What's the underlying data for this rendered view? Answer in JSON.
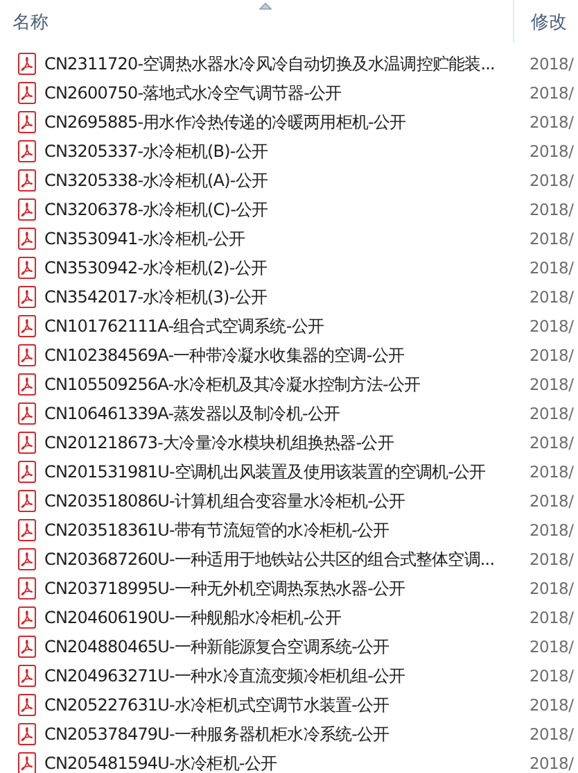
{
  "columns": [
    {
      "label": "名称",
      "sorted": true
    },
    {
      "label": "修改"
    }
  ],
  "rows": [
    {
      "name": "CN2311720-空调热水器水冷风冷自动切换及水温调控贮能装...",
      "modified": "2018/"
    },
    {
      "name": "CN2600750-落地式水冷空气调节器-公开",
      "modified": "2018/"
    },
    {
      "name": "CN2695885-用水作冷热传递的冷暖两用柜机-公开",
      "modified": "2018/"
    },
    {
      "name": "CN3205337-水冷柜机(B)-公开",
      "modified": "2018/"
    },
    {
      "name": "CN3205338-水冷柜机(A)-公开",
      "modified": "2018/"
    },
    {
      "name": "CN3206378-水冷柜机(C)-公开",
      "modified": "2018/"
    },
    {
      "name": "CN3530941-水冷柜机-公开",
      "modified": "2018/"
    },
    {
      "name": "CN3530942-水冷柜机(2)-公开",
      "modified": "2018/"
    },
    {
      "name": "CN3542017-水冷柜机(3)-公开",
      "modified": "2018/"
    },
    {
      "name": "CN101762111A-组合式空调系统-公开",
      "modified": "2018/"
    },
    {
      "name": "CN102384569A-一种带冷凝水收集器的空调-公开",
      "modified": "2018/"
    },
    {
      "name": "CN105509256A-水冷柜机及其冷凝水控制方法-公开",
      "modified": "2018/"
    },
    {
      "name": "CN106461339A-蒸发器以及制冷机-公开",
      "modified": "2018/"
    },
    {
      "name": "CN201218673-大冷量冷水模块机组换热器-公开",
      "modified": "2018/"
    },
    {
      "name": "CN201531981U-空调机出风装置及使用该装置的空调机-公开",
      "modified": "2018/"
    },
    {
      "name": "CN203518086U-计算机组合变容量水冷柜机-公开",
      "modified": "2018/"
    },
    {
      "name": "CN203518361U-带有节流短管的水冷柜机-公开",
      "modified": "2018/"
    },
    {
      "name": "CN203687260U-一种适用于地铁站公共区的组合式整体空调...",
      "modified": "2018/"
    },
    {
      "name": "CN203718995U-一种无外机空调热泵热水器-公开",
      "modified": "2018/"
    },
    {
      "name": "CN204606190U-一种舰船水冷柜机-公开",
      "modified": "2018/"
    },
    {
      "name": "CN204880465U-一种新能源复合空调系统-公开",
      "modified": "2018/"
    },
    {
      "name": "CN204963271U-一种水冷直流变频冷柜机组-公开",
      "modified": "2018/"
    },
    {
      "name": "CN205227631U-水冷柜机式空调节水装置-公开",
      "modified": "2018/"
    },
    {
      "name": "CN205378479U-一种服务器机柜水冷系统-公开",
      "modified": "2018/"
    },
    {
      "name": "CN205481594U-水冷柜机-公开",
      "modified": "2018/"
    }
  ]
}
